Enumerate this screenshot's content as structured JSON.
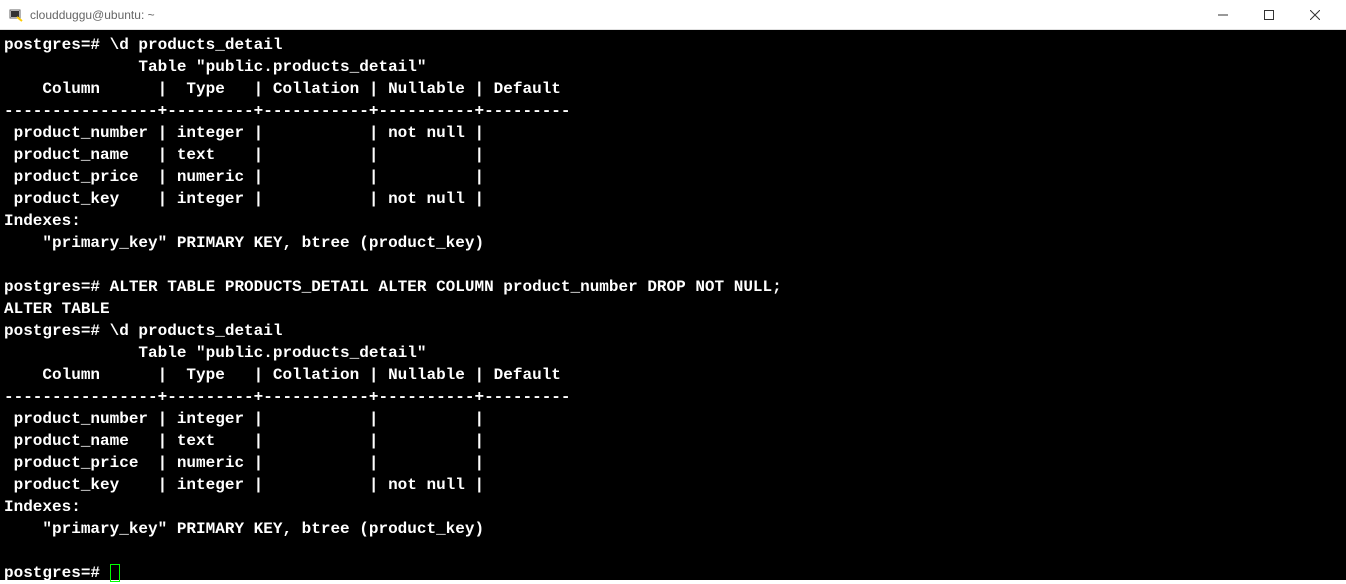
{
  "window": {
    "title": "cloudduggu@ubuntu: ~"
  },
  "terminal": {
    "prompt": "postgres=#",
    "cmd1": "\\d products_detail",
    "table_title": "Table \"public.products_detail\"",
    "header": "    Column      |  Type   | Collation | Nullable | Default",
    "separator": "----------------+---------+-----------+----------+---------",
    "row1_before": " product_number | integer |           | not null |",
    "row2": " product_name   | text    |           |          |",
    "row3": " product_price  | numeric |           |          |",
    "row4": " product_key    | integer |           | not null |",
    "indexes_label": "Indexes:",
    "index_line": "    \"primary_key\" PRIMARY KEY, btree (product_key)",
    "cmd2": "ALTER TABLE PRODUCTS_DETAIL ALTER COLUMN product_number DROP NOT NULL;",
    "alter_response": "ALTER TABLE",
    "cmd3": "\\d products_detail",
    "row1_after": " product_number | integer |           |          |"
  }
}
